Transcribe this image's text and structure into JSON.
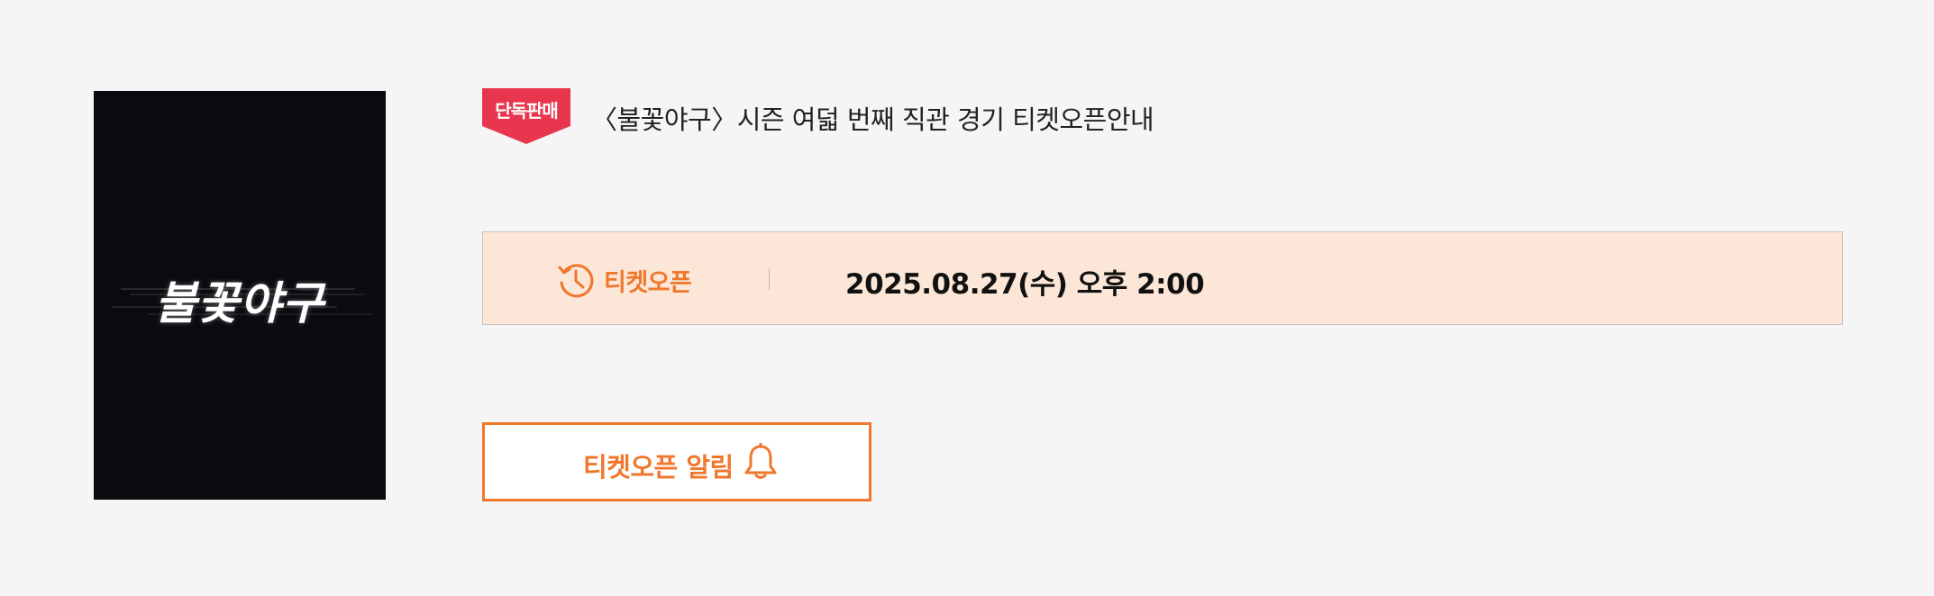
{
  "poster": {
    "title_text": "불꽃야구"
  },
  "badge": {
    "label": "단독판매",
    "color": "#e8364f"
  },
  "event": {
    "title": "〈불꽃야구〉시즌 여덟 번째 직관 경기 티켓오픈안내"
  },
  "ticket_open": {
    "label": "티켓오픈",
    "date": "2025.08.27(수) 오후 2:00",
    "icon": "history-clock-icon",
    "accent_color": "#f0772b",
    "background_color": "#fbe6d7"
  },
  "alert_button": {
    "label": "티켓오픈 알림",
    "icon": "bell-icon"
  }
}
